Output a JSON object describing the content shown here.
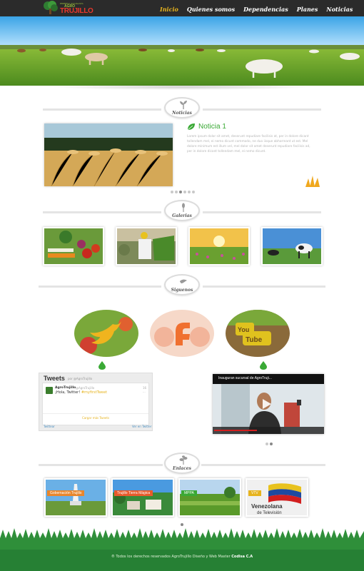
{
  "header": {
    "logo": {
      "small_text": "EMPRESA SOCIALISTA",
      "agro": "AGRO",
      "name": "TRUJILLO"
    },
    "nav": [
      {
        "label": "Inicio",
        "active": true
      },
      {
        "label": "Quienes somos",
        "active": false
      },
      {
        "label": "Dependencias",
        "active": false
      },
      {
        "label": "Planes",
        "active": false
      },
      {
        "label": "Noticias",
        "active": false
      }
    ]
  },
  "sections": {
    "news": {
      "badge": "Noticias"
    },
    "gallery": {
      "badge": "Galerias"
    },
    "social": {
      "badge": "Siguenos"
    },
    "links": {
      "badge": "Enlaces"
    }
  },
  "news": {
    "title": "Noticia 1",
    "body": "Lorem ipsum dolor sit amet, deserunt repudiare facilisis at, per in dolore dicant tollendam mel, ei nemo dicunt commodo, ne duo iisque abhorreant ut est. Mel dolore minimum est illum vel, mel dolor sit amet deserunt repudiare facilisis ad, per in dolore dicant tollendam mel, ei nemo dicunt."
  },
  "social": {
    "tweets": {
      "title": "Tweets",
      "by": "por @AgroTrujillo",
      "author": "AgroTrujillo",
      "handle": "@AgroTrujillo",
      "date": "16 ...",
      "msg_prefix": "¡Hola, Twitter! ",
      "msg_highlight": "#myfirstTweet",
      "load_more": "Cargar más Tweets",
      "footer_left": "Twittear",
      "footer_right": "Ver en Twitter"
    },
    "video": {
      "title": "Inauguran sucursal de AgroTruji..."
    }
  },
  "links": [
    {
      "label": "Gobernación Trujillo"
    },
    {
      "label": "Trujillo Tierra Mágica"
    },
    {
      "label": "MPPA"
    },
    {
      "label": "VTV"
    }
  ],
  "footer": {
    "text": "® Todos los derechos reservados AgroTrujillo Diseño y Web Master ",
    "brand": "Codisa C.A"
  },
  "colors": {
    "accent_yellow": "#e6b31e",
    "accent_green": "#3aa935",
    "topbar": "#2b2b2b",
    "logo_red": "#e8372c"
  }
}
